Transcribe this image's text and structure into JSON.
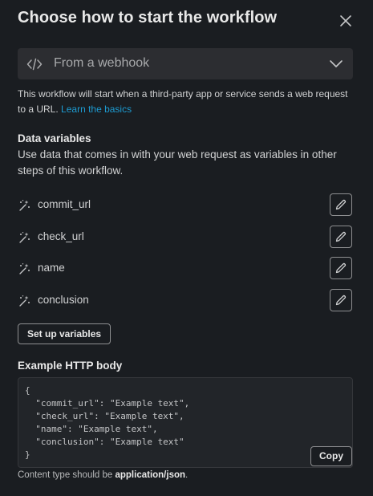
{
  "dialog": {
    "title": "Choose how to start the workflow",
    "close_icon": "close-icon"
  },
  "trigger_select": {
    "icon": "code-brackets-icon",
    "selected": "From a webhook",
    "chevron": "chevron-down-icon"
  },
  "description": {
    "text": "This workflow will start when a third-party app or service sends a web request to a URL.",
    "link": "Learn the basics"
  },
  "data_variables": {
    "heading": "Data variables",
    "subheading": "Use data that comes in with your web request as variables in other steps of this workflow.",
    "items": [
      {
        "name": "commit_url"
      },
      {
        "name": "check_url"
      },
      {
        "name": "name"
      },
      {
        "name": "conclusion"
      }
    ],
    "setup_button": "Set up variables"
  },
  "example": {
    "heading": "Example HTTP body",
    "body": "{\n  \"commit_url\": \"Example text\",\n  \"check_url\": \"Example text\",\n  \"name\": \"Example text\",\n  \"conclusion\": \"Example text\"\n}",
    "copy_button": "Copy"
  },
  "footnote": {
    "prefix": "Content type should be ",
    "content_type": "application/json",
    "suffix": "."
  },
  "colors": {
    "background": "#1a1d21",
    "select_bg": "#2c2d31",
    "link": "#1d9bd1",
    "border": "#8e8f91"
  }
}
